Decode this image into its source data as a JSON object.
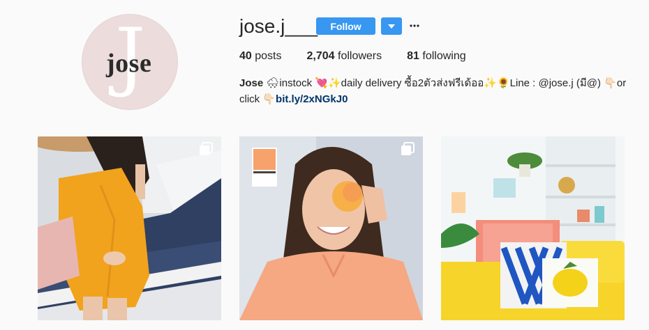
{
  "profile": {
    "avatar_letter": "J",
    "avatar_word": "jose",
    "username": "jose.j___",
    "follow_label": "Follow"
  },
  "stats": {
    "posts_count": "40",
    "posts_label": "posts",
    "followers_count": "2,704",
    "followers_label": "followers",
    "following_count": "81",
    "following_label": "following"
  },
  "bio": {
    "name": "Jose",
    "line1_text": "instock ",
    "line1_text2": "daily delivery ซื้อ2ตัวส่งฟรีเด้ออ",
    "line1_text3": "Line : @jose.j (มี@) ",
    "line1_text4": "or",
    "line2_prefix": "click ",
    "link": "bit.ly/2xNGkJ0",
    "emoji_snow": "🌨",
    "emoji_heart": "💘",
    "emoji_sparkle": "✨",
    "emoji_sunflower": "🌻",
    "emoji_point": "👇🏻"
  },
  "colors": {
    "follow_blue": "#3897f0",
    "link_blue": "#003569",
    "background": "#fafafa"
  },
  "posts": [
    {
      "label": "post-1",
      "multi": true
    },
    {
      "label": "post-2",
      "multi": true
    },
    {
      "label": "post-3",
      "multi": false
    }
  ]
}
